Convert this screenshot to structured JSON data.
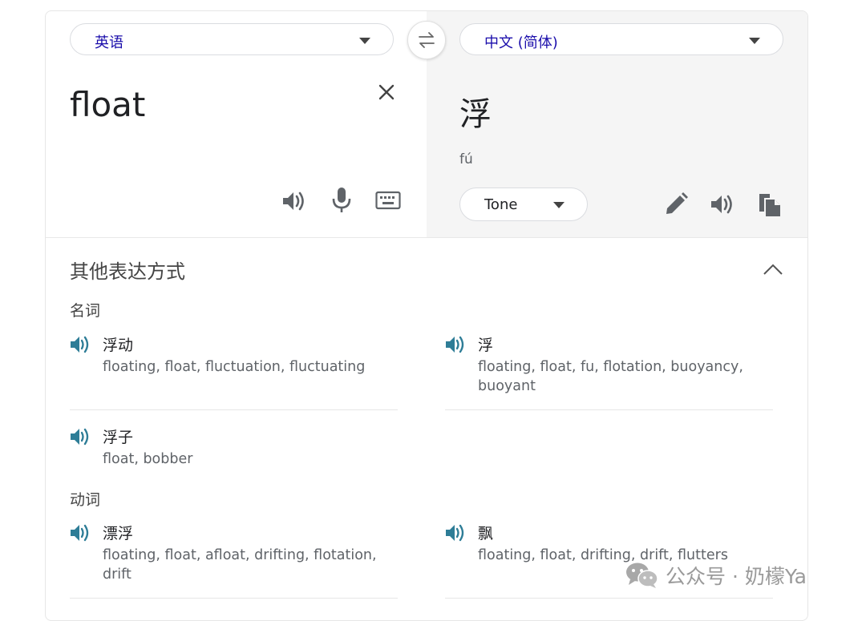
{
  "languages": {
    "source": "英语",
    "target": "中文 (简体)"
  },
  "source": {
    "text": "float"
  },
  "target": {
    "text": "浮",
    "transliteration": "fú",
    "tone_label": "Tone"
  },
  "alternatives": {
    "heading": "其他表达方式",
    "groups": [
      {
        "pos": "名词",
        "entries": [
          {
            "word": "浮动",
            "synonyms": "floating, float, fluctuation, fluctuating"
          },
          {
            "word": "浮",
            "synonyms": "floating, float, fu, flotation, buoyancy, buoyant"
          },
          {
            "word": "浮子",
            "synonyms": "float, bobber"
          }
        ]
      },
      {
        "pos": "动词",
        "entries": [
          {
            "word": "漂浮",
            "synonyms": "floating, float, afloat, drifting, flotation, drift"
          },
          {
            "word": "飘",
            "synonyms": "floating, float, drifting, drift, flutters"
          }
        ]
      }
    ]
  },
  "watermark": {
    "text": "公众号 · 奶檬Ya"
  },
  "colors": {
    "link": "#1a0dab",
    "speaker": "#2e7d97",
    "icon_gray": "#5f6368"
  }
}
